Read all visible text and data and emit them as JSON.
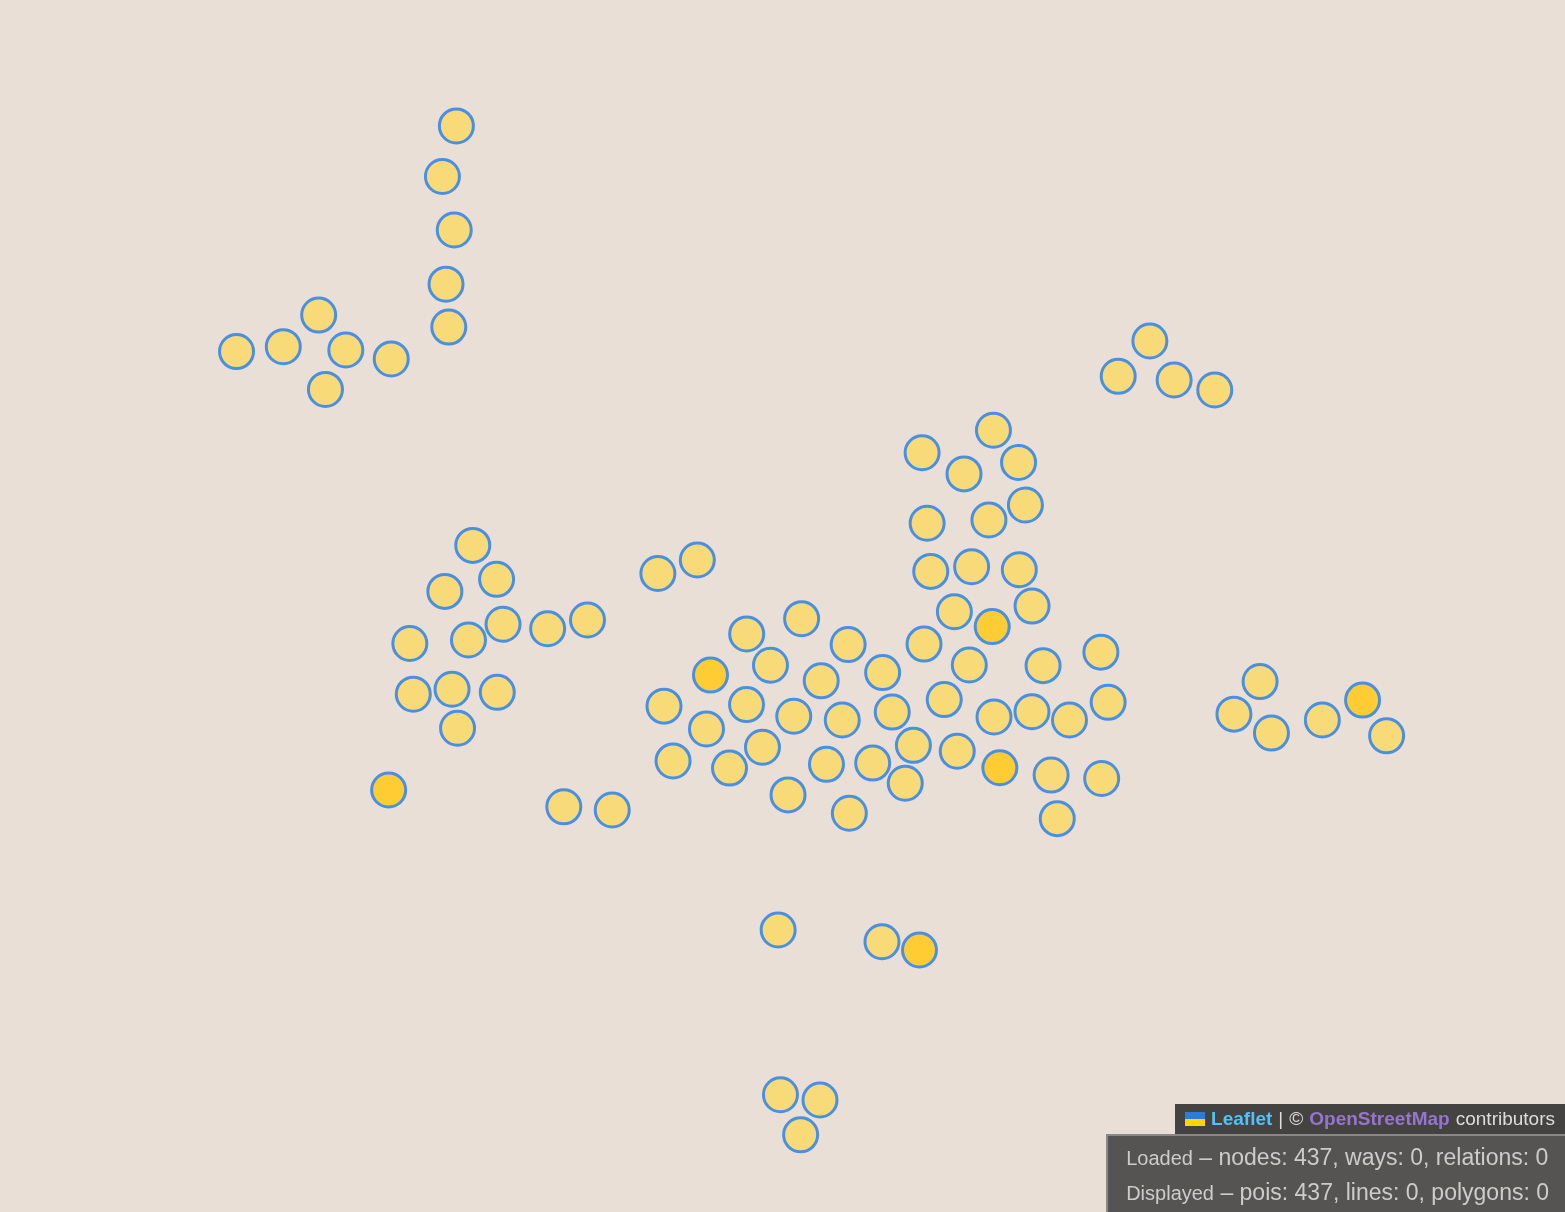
{
  "attribution": {
    "leaflet": "Leaflet",
    "separator": "|",
    "copyright": "©",
    "osm": "OpenStreetMap",
    "suffix": "contributors"
  },
  "status": [
    {
      "label": "Loaded",
      "text": "– nodes: 437, ways: 0, relations: 0"
    },
    {
      "label": "Displayed",
      "text": "– pois: 437, lines: 0, polygons: 0"
    }
  ]
}
